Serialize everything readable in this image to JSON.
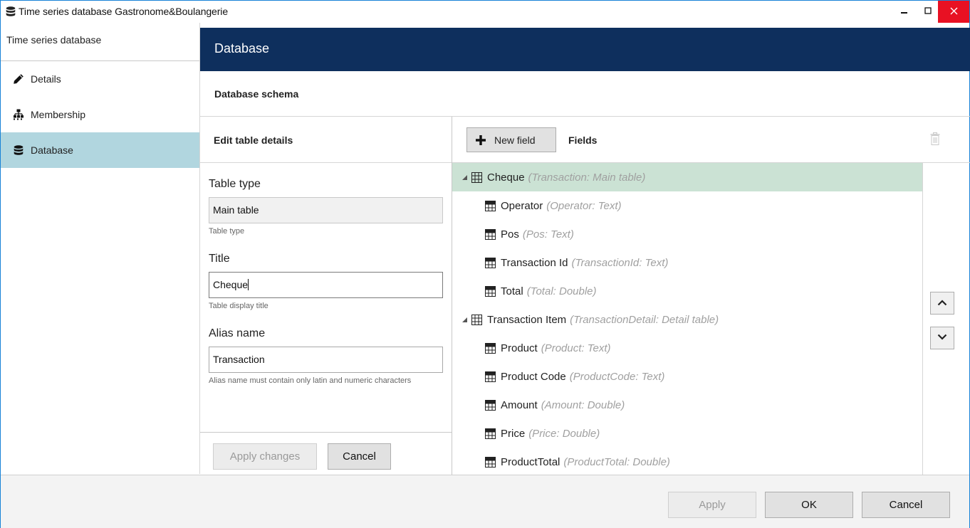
{
  "window": {
    "title": "Time series database Gastronome&Boulangerie",
    "icon": "database-icon",
    "controls": {
      "minimize": "minimize-icon",
      "maximize": "maximize-icon",
      "close": "close-icon"
    },
    "close_color": "#e81123"
  },
  "sidebar": {
    "title": "Time series database",
    "items": [
      {
        "label": "Details",
        "icon": "pencil-icon",
        "active": false
      },
      {
        "label": "Membership",
        "icon": "hierarchy-icon",
        "active": false
      },
      {
        "label": "Database",
        "icon": "database-icon",
        "active": true
      }
    ],
    "active_color": "#b1d6df"
  },
  "header": {
    "title": "Database",
    "color": "#0e2f5d"
  },
  "schema": {
    "title": "Database schema"
  },
  "edit": {
    "title": "Edit table details",
    "table_type": {
      "label": "Table type",
      "value": "Main table",
      "hint": "Table type"
    },
    "title_field": {
      "label": "Title",
      "value": "Cheque",
      "hint": "Table display title"
    },
    "alias": {
      "label": "Alias name",
      "value": "Transaction",
      "hint": "Alias name must contain only latin and numeric characters"
    },
    "apply_label": "Apply changes",
    "cancel_label": "Cancel"
  },
  "fields": {
    "new_field_label": "New field",
    "title": "Fields",
    "selected_color": "#cbe2d4",
    "tree": [
      {
        "name": "Cheque",
        "meta": "(Transaction: Main table)",
        "level": 0,
        "kind": "table",
        "selected": true
      },
      {
        "name": "Operator",
        "meta": "(Operator: Text)",
        "level": 1,
        "kind": "field"
      },
      {
        "name": "Pos",
        "meta": "(Pos: Text)",
        "level": 1,
        "kind": "field"
      },
      {
        "name": "Transaction Id",
        "meta": "(TransactionId: Text)",
        "level": 1,
        "kind": "field"
      },
      {
        "name": "Total",
        "meta": "(Total: Double)",
        "level": 1,
        "kind": "field"
      },
      {
        "name": "Transaction Item",
        "meta": "(TransactionDetail: Detail table)",
        "level": 0,
        "kind": "table"
      },
      {
        "name": "Product",
        "meta": "(Product: Text)",
        "level": 1,
        "kind": "field"
      },
      {
        "name": "Product Code",
        "meta": "(ProductCode: Text)",
        "level": 1,
        "kind": "field"
      },
      {
        "name": "Amount",
        "meta": "(Amount: Double)",
        "level": 1,
        "kind": "field"
      },
      {
        "name": "Price",
        "meta": "(Price: Double)",
        "level": 1,
        "kind": "field"
      },
      {
        "name": "ProductTotal",
        "meta": "(ProductTotal: Double)",
        "level": 1,
        "kind": "field"
      }
    ]
  },
  "footer": {
    "apply_label": "Apply",
    "ok_label": "OK",
    "cancel_label": "Cancel"
  }
}
